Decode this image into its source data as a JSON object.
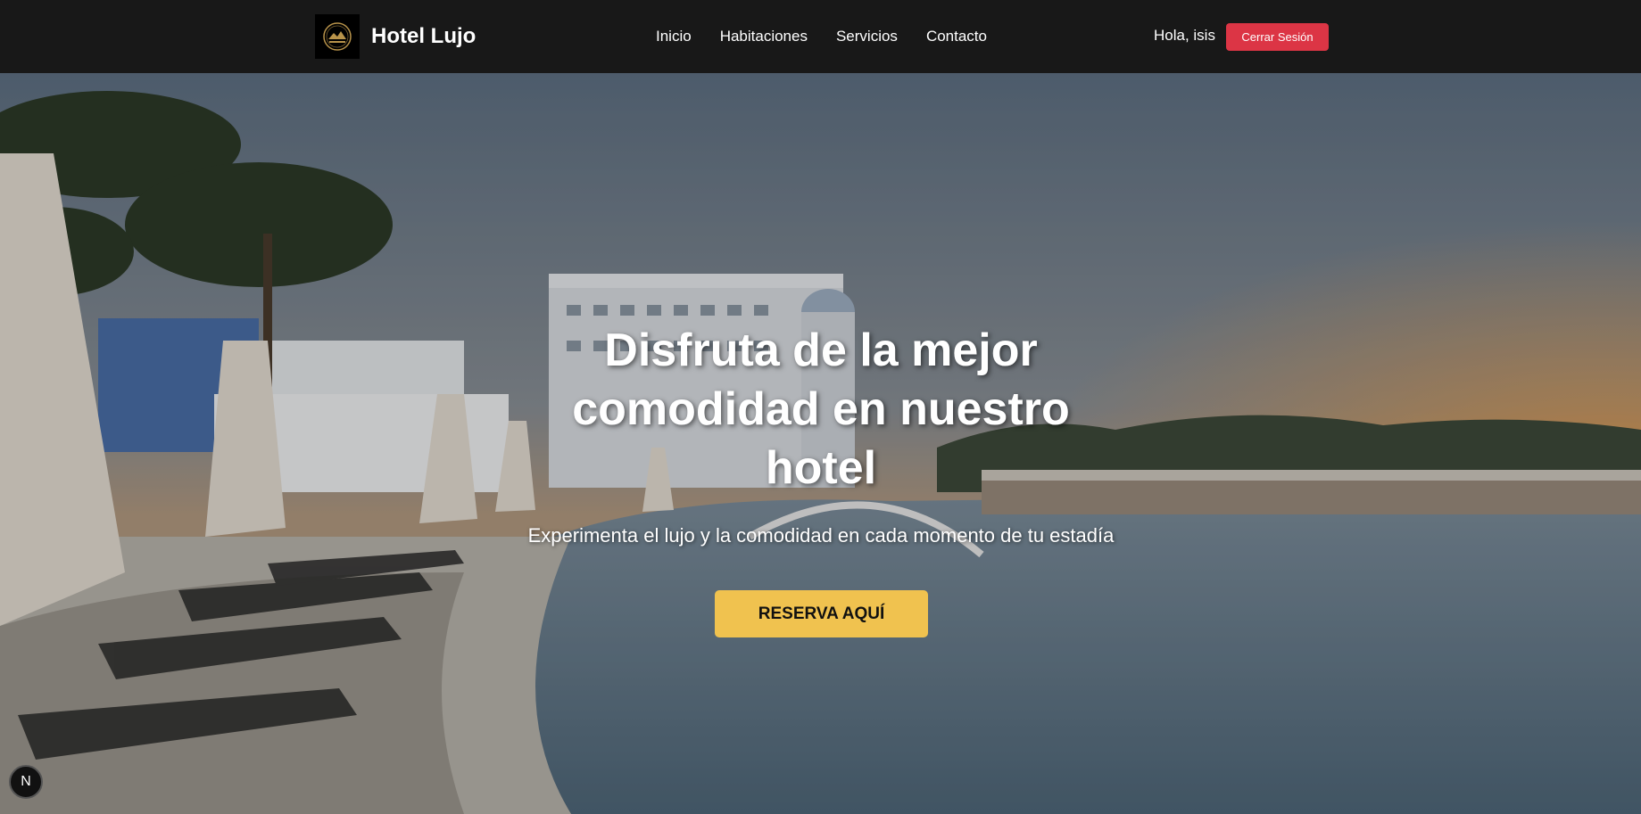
{
  "navbar": {
    "brand_name": "Hotel Lujo",
    "logo_icon": "hotel-logo-icon",
    "links": [
      "Inicio",
      "Habitaciones",
      "Servicios",
      "Contacto"
    ],
    "greeting": "Hola, isis",
    "logout_label": "Cerrar Sesión"
  },
  "hero": {
    "title": "Disfruta de la mejor comodidad en nuestro hotel",
    "subtitle": "Experimenta el lujo y la comodidad en cada momento de tu estadía",
    "cta_label": "RESERVA AQUÍ"
  },
  "dev_badge": {
    "label": "N"
  },
  "colors": {
    "navbar_bg": "#181818",
    "logout_bg": "#dc3545",
    "cta_bg": "#f0c24f"
  }
}
